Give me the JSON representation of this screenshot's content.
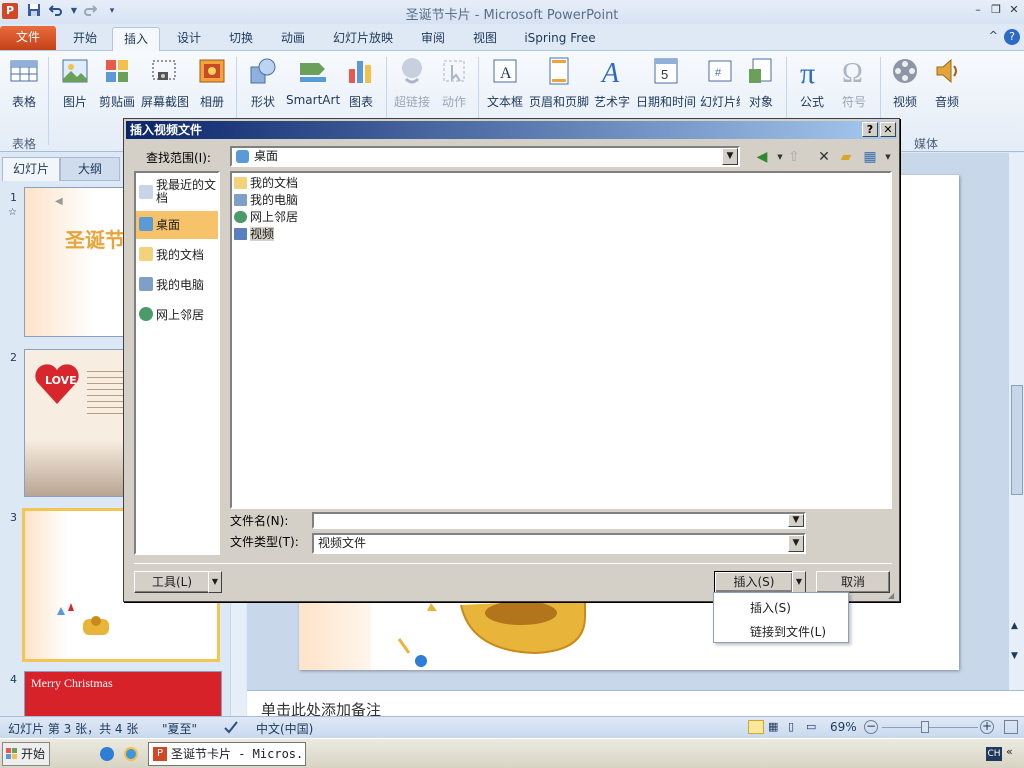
{
  "window": {
    "title": "圣诞节卡片 - Microsoft PowerPoint",
    "app_icon_letter": "P",
    "quick_access": {
      "save_icon": "save-icon",
      "undo_icon": "undo-icon",
      "redo_icon": "redo-icon",
      "customize_icon": "customize-qat-icon"
    },
    "controls": {
      "minimize": "–",
      "restore": "❐",
      "close": "✕"
    }
  },
  "ribbon_tabs": {
    "file": "文件",
    "tabs": [
      "开始",
      "插入",
      "设计",
      "切换",
      "动画",
      "幻灯片放映",
      "审阅",
      "视图",
      "iSpring Free"
    ],
    "active": "插入",
    "help": "?",
    "minimize_ribbon": "^"
  },
  "ribbon": {
    "buttons": [
      "表格",
      "图片",
      "剪贴画",
      "屏幕截图",
      "相册",
      "形状",
      "SmartArt",
      "图表",
      "超链接",
      "动作",
      "文本框",
      "页眉和页脚",
      "艺术字",
      "日期和时间",
      "幻灯片编号",
      "对象",
      "公式",
      "符号",
      "视频",
      "音频"
    ],
    "groups": [
      "表格",
      "媒体"
    ]
  },
  "left_pane": {
    "tabs": [
      "幻灯片",
      "大纲"
    ],
    "slide_numbers": [
      "1",
      "2",
      "3",
      "4"
    ],
    "thumb_texts": {
      "slide1_title": "圣诞节",
      "slide2_heart": "LOVE",
      "slide4_title": "Merry Christmas"
    },
    "slide1_star": "☆"
  },
  "notes": {
    "placeholder": "单击此处添加备注"
  },
  "status": {
    "slide_info": "幻灯片 第 3 张，共 4 张",
    "theme": "\"夏至\"",
    "language": "中文(中国)",
    "zoom": "69%",
    "zoom_fraction": 0.45
  },
  "taskbar": {
    "start": "开始",
    "task_label": "圣诞节卡片 - Micros..."
  },
  "dialog": {
    "title": "插入视频文件",
    "help_btn": "?",
    "close_btn": "✕",
    "look_in_label": "查找范围(I):",
    "look_in_value": "桌面",
    "places": [
      "我最近的文档",
      "桌面",
      "我的文档",
      "我的电脑",
      "网上邻居"
    ],
    "selected_place": "桌面",
    "files": [
      "我的文档",
      "我的电脑",
      "网上邻居",
      "视频"
    ],
    "selected_file": "视频",
    "filename_label": "文件名(N):",
    "filename_value": "",
    "filetype_label": "文件类型(T):",
    "filetype_value": "视频文件",
    "tools_button": "工具(L)",
    "insert_button": "插入(S)",
    "cancel_button": "取消"
  },
  "insert_menu": {
    "items": [
      "插入(S)",
      "链接到文件(L)"
    ]
  },
  "colors": {
    "file_tab": "#d24726",
    "dialog_title": "#0a246a",
    "selected_place": "#f7c36a",
    "selected_thumb": "#f5c553"
  }
}
